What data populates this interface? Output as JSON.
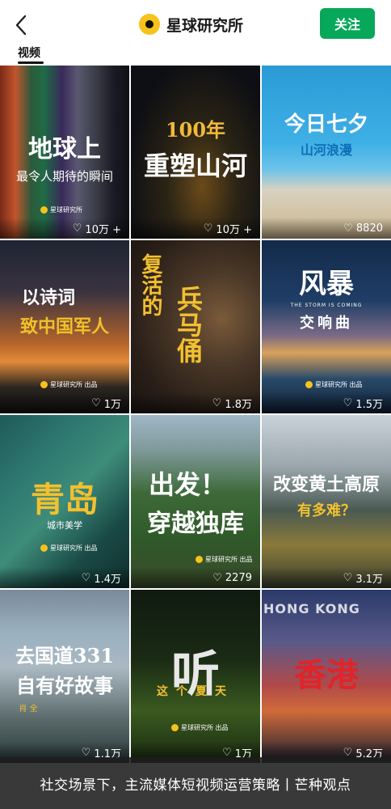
{
  "header": {
    "back_icon": "chevron-left-icon",
    "title": "星球研究所",
    "follow_label": "关注",
    "tab_label": "视频",
    "logo_color": "#f6c21c",
    "follow_color": "#07a85a"
  },
  "tiles": [
    {
      "line1": "地球上",
      "line2": "最令人期待的瞬间",
      "likes": "10万 +",
      "brand": "星球研究所"
    },
    {
      "line1": "100年",
      "line2": "重塑山河",
      "likes": "10万 +",
      "brand": ""
    },
    {
      "line1": "今日七夕",
      "line2": "山河浪漫",
      "likes": "8820",
      "brand": ""
    },
    {
      "line1": "以诗词",
      "line2": "致中国军人",
      "likes": "1万",
      "brand": "星球研究所 出品"
    },
    {
      "line1": "复活的",
      "line2": "兵马俑",
      "likes": "1.8万",
      "brand": ""
    },
    {
      "line1": "风暴",
      "line2": "交响曲",
      "likes": "1.5万",
      "brand": "星球研究所 出品",
      "sub": "THE STORM IS COMING"
    },
    {
      "line1": "青岛",
      "line2": "城市美学",
      "likes": "1.4万",
      "brand": "星球研究所 出品"
    },
    {
      "line1": "出发！",
      "line2": "穿越独库",
      "likes": "2279",
      "brand": "星球研究所 出品"
    },
    {
      "line1": "改变黄土高原",
      "line2": "有多难？",
      "likes": "3.1万",
      "brand": ""
    },
    {
      "line1": "去国道331",
      "line2": "自有好故事",
      "likes": "1.1万",
      "brand": "",
      "sub": "肖 全"
    },
    {
      "line1": "听",
      "line2": "这个夏天",
      "likes": "1万",
      "brand": "星球研究所 出品"
    },
    {
      "line1": "香港",
      "line2": "HONG KONG",
      "likes": "5.2万",
      "brand": ""
    }
  ],
  "caption": "社交场景下，主流媒体短视频运营策略丨芒种观点"
}
